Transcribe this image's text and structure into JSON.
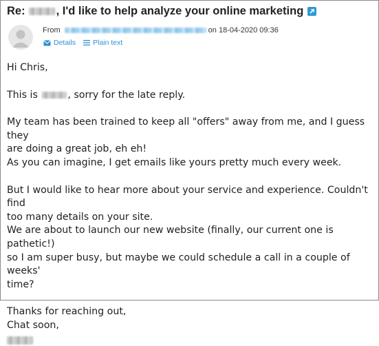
{
  "email": {
    "subject_prefix": "Re:",
    "subject_rest": ", I'd like to help analyze your online marketing",
    "from_label": "From",
    "date_text": "on 18-04-2020 09:36",
    "details_label": "Details",
    "plain_text_label": "Plain text"
  },
  "body": {
    "greeting": "Hi Chris,",
    "line_this_is_a": "This is",
    "line_this_is_b": ", sorry for the late reply.",
    "para2_line1": "My team has been trained to keep all \"offers\" away from me, and I guess they",
    "para2_line2": "are doing a great job, eh eh!",
    "para2_line3": "As you can imagine, I get emails like yours pretty much every week.",
    "para3_line1": "But I would like to hear more about your service and experience. Couldn't find",
    "para3_line2": "too many details on your site.",
    "para3_line3": "We are about to launch our new website (finally, our current one is pathetic!)",
    "para3_line4": "so I am super busy, but maybe we could schedule a call in a couple of weeks'",
    "para3_line5": "time?",
    "closing_line1": "Thanks for reaching out,",
    "closing_line2": "Chat soon,"
  },
  "colors": {
    "link": "#2f8fd0",
    "ext_icon": "#2f9ad6",
    "border": "#8a8a8a"
  },
  "icons": {
    "external": "external-link-icon",
    "avatar": "user-avatar-icon",
    "details": "envelope-icon",
    "plain_text": "lines-icon"
  }
}
